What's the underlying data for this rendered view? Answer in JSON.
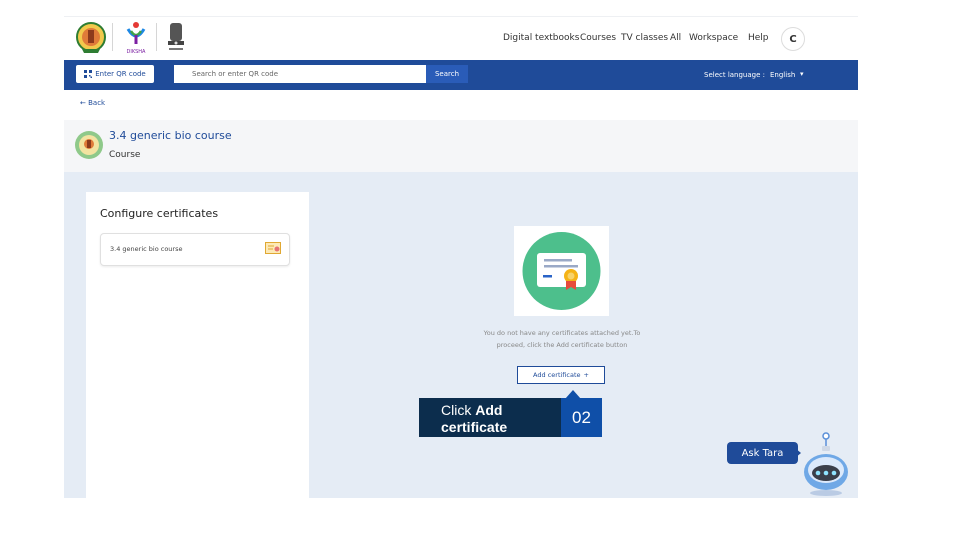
{
  "header": {
    "nav": [
      "Digital textbooks",
      "Courses",
      "TV classes",
      "All",
      "Workspace",
      "Help"
    ],
    "avatar_initial": "C",
    "logo_diksha_text": "DIKSHA"
  },
  "toolbar": {
    "qr_button_label": "Enter QR code",
    "search_placeholder": "Search or enter QR code",
    "search_button_label": "Search",
    "language_label": "Select language :",
    "language_value": "English"
  },
  "back_label": "Back",
  "course": {
    "title": "3.4 generic bio course",
    "type": "Course"
  },
  "configure": {
    "title": "Configure certificates",
    "items": [
      {
        "label": "3.4 generic bio course"
      }
    ]
  },
  "empty_state": {
    "line1": "You do not have any certificates attached yet.To",
    "line2": "proceed, click the Add certificate button",
    "add_button_label": "Add certificate",
    "add_button_icon": "+"
  },
  "callout": {
    "prefix": "Click ",
    "bold1": "Add",
    "bold2": "certificate",
    "step": "02"
  },
  "assistant": {
    "label": "Ask Tara"
  },
  "colors": {
    "primary": "#1f4b99",
    "content_bg": "#e5ecf5",
    "callout_dark": "#0c2d4d",
    "callout_blue": "#0f4fa8",
    "cert_green": "#4dbf8c"
  }
}
